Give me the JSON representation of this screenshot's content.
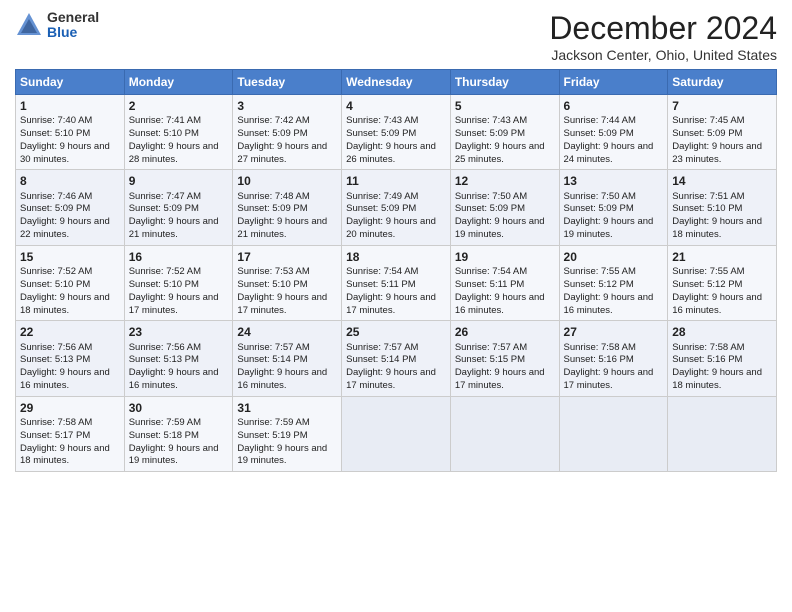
{
  "logo": {
    "general": "General",
    "blue": "Blue"
  },
  "title": "December 2024",
  "location": "Jackson Center, Ohio, United States",
  "days_header": [
    "Sunday",
    "Monday",
    "Tuesday",
    "Wednesday",
    "Thursday",
    "Friday",
    "Saturday"
  ],
  "weeks": [
    [
      {
        "day": "1",
        "sunrise": "Sunrise: 7:40 AM",
        "sunset": "Sunset: 5:10 PM",
        "daylight": "Daylight: 9 hours and 30 minutes."
      },
      {
        "day": "2",
        "sunrise": "Sunrise: 7:41 AM",
        "sunset": "Sunset: 5:10 PM",
        "daylight": "Daylight: 9 hours and 28 minutes."
      },
      {
        "day": "3",
        "sunrise": "Sunrise: 7:42 AM",
        "sunset": "Sunset: 5:09 PM",
        "daylight": "Daylight: 9 hours and 27 minutes."
      },
      {
        "day": "4",
        "sunrise": "Sunrise: 7:43 AM",
        "sunset": "Sunset: 5:09 PM",
        "daylight": "Daylight: 9 hours and 26 minutes."
      },
      {
        "day": "5",
        "sunrise": "Sunrise: 7:43 AM",
        "sunset": "Sunset: 5:09 PM",
        "daylight": "Daylight: 9 hours and 25 minutes."
      },
      {
        "day": "6",
        "sunrise": "Sunrise: 7:44 AM",
        "sunset": "Sunset: 5:09 PM",
        "daylight": "Daylight: 9 hours and 24 minutes."
      },
      {
        "day": "7",
        "sunrise": "Sunrise: 7:45 AM",
        "sunset": "Sunset: 5:09 PM",
        "daylight": "Daylight: 9 hours and 23 minutes."
      }
    ],
    [
      {
        "day": "8",
        "sunrise": "Sunrise: 7:46 AM",
        "sunset": "Sunset: 5:09 PM",
        "daylight": "Daylight: 9 hours and 22 minutes."
      },
      {
        "day": "9",
        "sunrise": "Sunrise: 7:47 AM",
        "sunset": "Sunset: 5:09 PM",
        "daylight": "Daylight: 9 hours and 21 minutes."
      },
      {
        "day": "10",
        "sunrise": "Sunrise: 7:48 AM",
        "sunset": "Sunset: 5:09 PM",
        "daylight": "Daylight: 9 hours and 21 minutes."
      },
      {
        "day": "11",
        "sunrise": "Sunrise: 7:49 AM",
        "sunset": "Sunset: 5:09 PM",
        "daylight": "Daylight: 9 hours and 20 minutes."
      },
      {
        "day": "12",
        "sunrise": "Sunrise: 7:50 AM",
        "sunset": "Sunset: 5:09 PM",
        "daylight": "Daylight: 9 hours and 19 minutes."
      },
      {
        "day": "13",
        "sunrise": "Sunrise: 7:50 AM",
        "sunset": "Sunset: 5:09 PM",
        "daylight": "Daylight: 9 hours and 19 minutes."
      },
      {
        "day": "14",
        "sunrise": "Sunrise: 7:51 AM",
        "sunset": "Sunset: 5:10 PM",
        "daylight": "Daylight: 9 hours and 18 minutes."
      }
    ],
    [
      {
        "day": "15",
        "sunrise": "Sunrise: 7:52 AM",
        "sunset": "Sunset: 5:10 PM",
        "daylight": "Daylight: 9 hours and 18 minutes."
      },
      {
        "day": "16",
        "sunrise": "Sunrise: 7:52 AM",
        "sunset": "Sunset: 5:10 PM",
        "daylight": "Daylight: 9 hours and 17 minutes."
      },
      {
        "day": "17",
        "sunrise": "Sunrise: 7:53 AM",
        "sunset": "Sunset: 5:10 PM",
        "daylight": "Daylight: 9 hours and 17 minutes."
      },
      {
        "day": "18",
        "sunrise": "Sunrise: 7:54 AM",
        "sunset": "Sunset: 5:11 PM",
        "daylight": "Daylight: 9 hours and 17 minutes."
      },
      {
        "day": "19",
        "sunrise": "Sunrise: 7:54 AM",
        "sunset": "Sunset: 5:11 PM",
        "daylight": "Daylight: 9 hours and 16 minutes."
      },
      {
        "day": "20",
        "sunrise": "Sunrise: 7:55 AM",
        "sunset": "Sunset: 5:12 PM",
        "daylight": "Daylight: 9 hours and 16 minutes."
      },
      {
        "day": "21",
        "sunrise": "Sunrise: 7:55 AM",
        "sunset": "Sunset: 5:12 PM",
        "daylight": "Daylight: 9 hours and 16 minutes."
      }
    ],
    [
      {
        "day": "22",
        "sunrise": "Sunrise: 7:56 AM",
        "sunset": "Sunset: 5:13 PM",
        "daylight": "Daylight: 9 hours and 16 minutes."
      },
      {
        "day": "23",
        "sunrise": "Sunrise: 7:56 AM",
        "sunset": "Sunset: 5:13 PM",
        "daylight": "Daylight: 9 hours and 16 minutes."
      },
      {
        "day": "24",
        "sunrise": "Sunrise: 7:57 AM",
        "sunset": "Sunset: 5:14 PM",
        "daylight": "Daylight: 9 hours and 16 minutes."
      },
      {
        "day": "25",
        "sunrise": "Sunrise: 7:57 AM",
        "sunset": "Sunset: 5:14 PM",
        "daylight": "Daylight: 9 hours and 17 minutes."
      },
      {
        "day": "26",
        "sunrise": "Sunrise: 7:57 AM",
        "sunset": "Sunset: 5:15 PM",
        "daylight": "Daylight: 9 hours and 17 minutes."
      },
      {
        "day": "27",
        "sunrise": "Sunrise: 7:58 AM",
        "sunset": "Sunset: 5:16 PM",
        "daylight": "Daylight: 9 hours and 17 minutes."
      },
      {
        "day": "28",
        "sunrise": "Sunrise: 7:58 AM",
        "sunset": "Sunset: 5:16 PM",
        "daylight": "Daylight: 9 hours and 18 minutes."
      }
    ],
    [
      {
        "day": "29",
        "sunrise": "Sunrise: 7:58 AM",
        "sunset": "Sunset: 5:17 PM",
        "daylight": "Daylight: 9 hours and 18 minutes."
      },
      {
        "day": "30",
        "sunrise": "Sunrise: 7:59 AM",
        "sunset": "Sunset: 5:18 PM",
        "daylight": "Daylight: 9 hours and 19 minutes."
      },
      {
        "day": "31",
        "sunrise": "Sunrise: 7:59 AM",
        "sunset": "Sunset: 5:19 PM",
        "daylight": "Daylight: 9 hours and 19 minutes."
      },
      null,
      null,
      null,
      null
    ]
  ]
}
